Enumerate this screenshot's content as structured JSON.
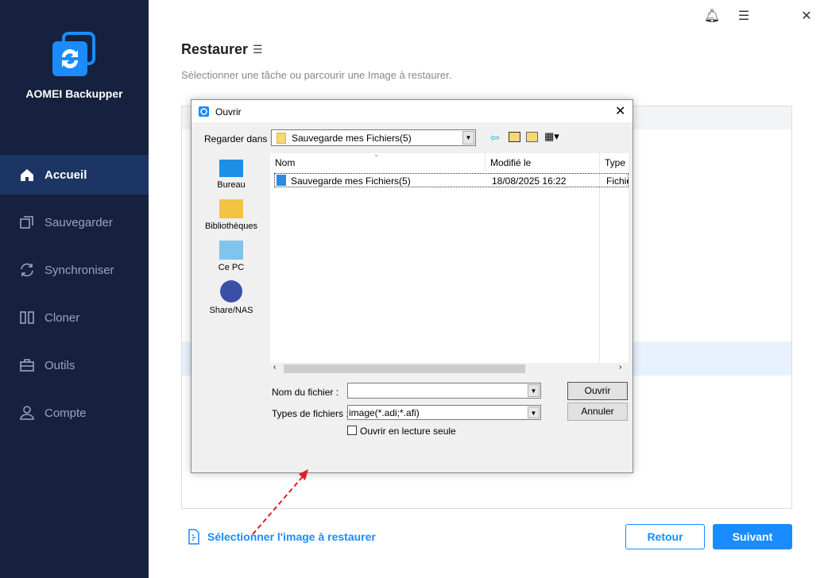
{
  "app": {
    "name": "AOMEI Backupper",
    "brand_color": "#1a8cff"
  },
  "sidebar": {
    "items": [
      {
        "label": "Accueil",
        "icon": "home-icon",
        "active": true
      },
      {
        "label": "Sauvegarder",
        "icon": "copy-icon"
      },
      {
        "label": "Synchroniser",
        "icon": "sync-icon"
      },
      {
        "label": "Cloner",
        "icon": "clone-icon"
      },
      {
        "label": "Outils",
        "icon": "toolbox-icon"
      },
      {
        "label": "Compte",
        "icon": "user-icon"
      }
    ]
  },
  "header": {
    "title": "Restaurer",
    "subtitle": "Sélectionner une tâche ou parcourir une Image à restaurer."
  },
  "dialog": {
    "title": "Ouvrir",
    "look_in_label": "Regarder dans :",
    "look_in_value": "Sauvegarde mes Fichiers(5)",
    "places": [
      "Bureau",
      "Bibliothèques",
      "Ce PC",
      "Share/NAS"
    ],
    "columns": [
      "Nom",
      "Modifié le",
      "Type"
    ],
    "rows": [
      {
        "name": "Sauvegarde mes Fichiers(5)",
        "modified": "18/08/2025 16:22",
        "type": "Fichie"
      }
    ],
    "filename_label": "Nom du fichier :",
    "filename_value": "",
    "filetype_label": "Types de fichiers :",
    "filetype_value": "image(*.adi;*.afi)",
    "readonly_label": "Ouvrir en lecture seule",
    "readonly_checked": false,
    "open_label": "Ouvrir",
    "cancel_label": "Annuler"
  },
  "footer": {
    "select_image_link": "Sélectionner l'image à restaurer",
    "back_label": "Retour",
    "next_label": "Suivant"
  }
}
